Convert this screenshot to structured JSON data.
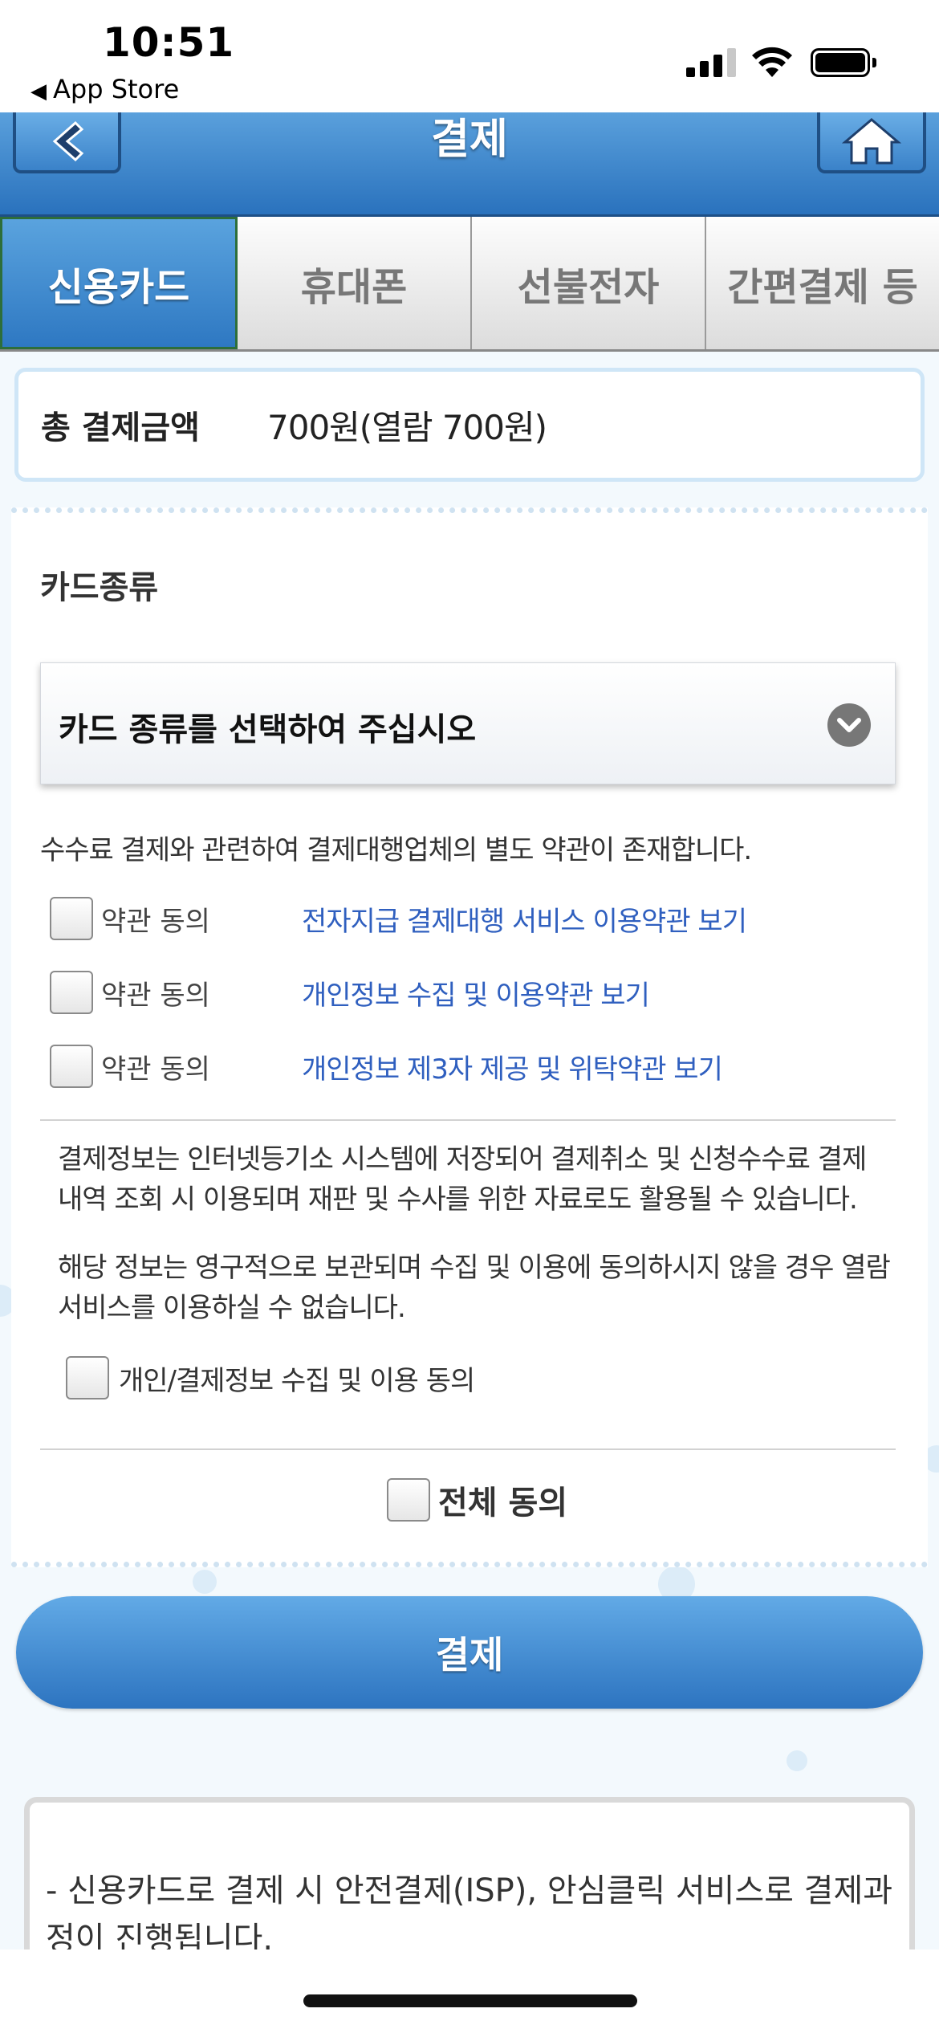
{
  "status_bar": {
    "time": "10:51",
    "back_app": "App Store"
  },
  "header": {
    "title": "결제"
  },
  "tabs": [
    {
      "label": "신용카드",
      "active": true
    },
    {
      "label": "휴대폰",
      "active": false
    },
    {
      "label": "선불전자",
      "active": false
    },
    {
      "label": "간편결제 등",
      "active": false
    }
  ],
  "total": {
    "label": "총 결제금액",
    "value": "700원(열람 700원)"
  },
  "card": {
    "section_title": "카드종류",
    "select_placeholder": "카드 종류를 선택하여 주십시오"
  },
  "notice": "수수료 결제와 관련하여 결제대행업체의 별도 약관이 존재합니다.",
  "agreements": [
    {
      "label": "약관 동의",
      "link": "전자지급 결제대행 서비스 이용약관 보기"
    },
    {
      "label": "약관 동의",
      "link": "개인정보 수집 및 이용약관 보기"
    },
    {
      "label": "약관 동의",
      "link": "개인정보 제3자 제공 및 위탁약관 보기"
    }
  ],
  "info": {
    "paragraph1": "결제정보는 인터넷등기소 시스템에 저장되어 결제취소 및 신청수수료 결제 내역 조회 시 이용되며 재판 및 수사를 위한 자료로도 활용될 수 있습니다.",
    "paragraph2": "해당 정보는 영구적으로 보관되며 수집 및 이용에 동의하시지 않을 경우 열람 서비스를 이용하실 수 없습니다.",
    "consent_label": "개인/결제정보 수집 및 이용 동의"
  },
  "all_agree_label": "전체 동의",
  "pay_button": "결제",
  "bottom_notice": "- 신용카드로 결제 시 안전결제(ISP), 안심클릭 서비스로 결제과정이 진행됩니다.",
  "colors": {
    "header_blue": "#2a72bd",
    "link_blue": "#2f5fbf",
    "active_tab": "#3a86cc"
  }
}
